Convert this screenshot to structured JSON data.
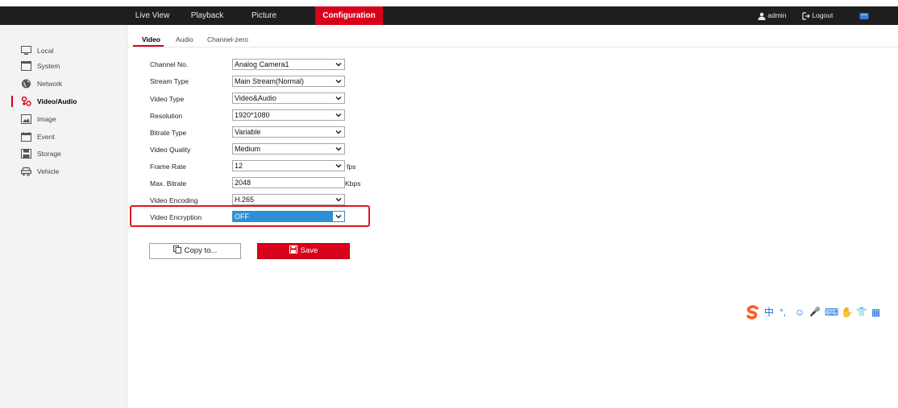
{
  "topnav": {
    "items": [
      {
        "label": "Live View"
      },
      {
        "label": "Playback"
      },
      {
        "label": "Picture"
      },
      {
        "label": "Configuration",
        "active": true
      }
    ],
    "user": "admin",
    "logout": "Logout",
    "active_color": "#d8001a"
  },
  "sidebar": {
    "items": [
      {
        "label": "Local",
        "icon": "monitor-icon"
      },
      {
        "label": "System",
        "icon": "window-icon"
      },
      {
        "label": "Network",
        "icon": "globe-icon"
      },
      {
        "label": "Video/Audio",
        "icon": "video-audio-icon",
        "active": true
      },
      {
        "label": "Image",
        "icon": "image-icon"
      },
      {
        "label": "Event",
        "icon": "calendar-icon"
      },
      {
        "label": "Storage",
        "icon": "floppy-icon"
      },
      {
        "label": "Vehicle",
        "icon": "vehicle-icon"
      }
    ]
  },
  "tabs": [
    {
      "label": "Video",
      "active": true
    },
    {
      "label": "Audio"
    },
    {
      "label": "Channel-zero"
    }
  ],
  "form": {
    "fields": [
      {
        "label": "Channel No.",
        "value": "Analog Camera1"
      },
      {
        "label": "Stream Type",
        "value": "Main Stream(Normal)"
      },
      {
        "label": "Video Type",
        "value": "Video&Audio"
      },
      {
        "label": "Resolution",
        "value": "1920*1080"
      },
      {
        "label": "Bitrate Type",
        "value": "Variable"
      },
      {
        "label": "Video Quality",
        "value": "Medium"
      },
      {
        "label": "Frame Rate",
        "value": "12",
        "unit": "fps"
      },
      {
        "label": "Max. Bitrate",
        "value": "2048",
        "unit": "Kbps"
      },
      {
        "label": "Video Encoding",
        "value": "H.265"
      },
      {
        "label": "Video Encryption",
        "value": "OFF",
        "highlighted": true
      }
    ]
  },
  "buttons": {
    "copy": "Copy to...",
    "save": "Save"
  },
  "ime_toolbar": {
    "glyphs": [
      "中",
      "°,",
      "☺",
      "🎤",
      "⌨",
      "👕",
      "▦"
    ]
  }
}
